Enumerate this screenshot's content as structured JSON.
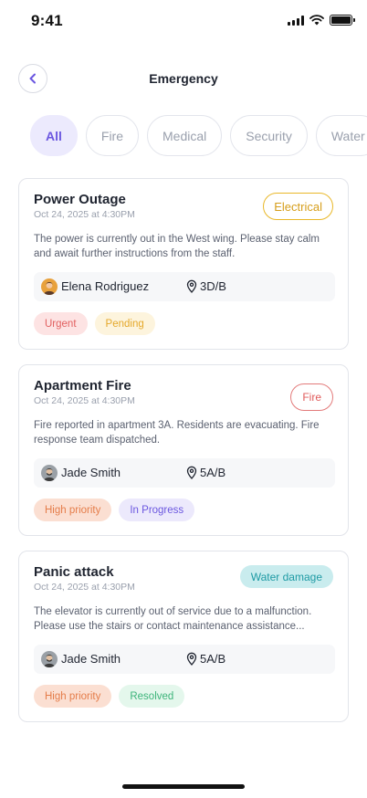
{
  "status_bar": {
    "time": "9:41"
  },
  "header": {
    "title": "Emergency"
  },
  "tabs": [
    {
      "label": "All",
      "active": true
    },
    {
      "label": "Fire",
      "active": false
    },
    {
      "label": "Medical",
      "active": false
    },
    {
      "label": "Security",
      "active": false
    },
    {
      "label": "Water",
      "active": false
    }
  ],
  "cards": [
    {
      "title": "Power Outage",
      "date": "Oct 24, 2025  at  4:30PM",
      "category": "Electrical",
      "description": "The power is currently out in the West wing. Please stay calm and await further instructions from the staff.",
      "reporter": "Elena Rodriguez",
      "room": "3D/B",
      "badges": [
        "Urgent",
        "Pending"
      ]
    },
    {
      "title": "Apartment Fire",
      "date": "Oct 24, 2025  at  4:30PM",
      "category": "Fire",
      "description": "Fire reported in apartment 3A. Residents are evacuating. Fire response team dispatched.",
      "reporter": "Jade Smith",
      "room": "5A/B",
      "badges": [
        "High priority",
        "In Progress"
      ]
    },
    {
      "title": "Panic attack",
      "date": "Oct 24, 2025  at  4:30PM",
      "category": "Water damage",
      "description": "The elevator is currently out of service due to a malfunction. Please use the stairs or contact maintenance assistance...",
      "reporter": "Jade Smith",
      "room": "5A/B",
      "badges": [
        "High priority",
        "Resolved"
      ]
    }
  ],
  "colors": {
    "accent": "#6b57e0",
    "electrical": "#e9b829",
    "fire": "#e05a5a",
    "water": "#1e9aa4"
  },
  "icons": [
    "back-chevron-icon",
    "signal-icon",
    "wifi-icon",
    "battery-icon",
    "location-pin-icon",
    "avatar"
  ]
}
